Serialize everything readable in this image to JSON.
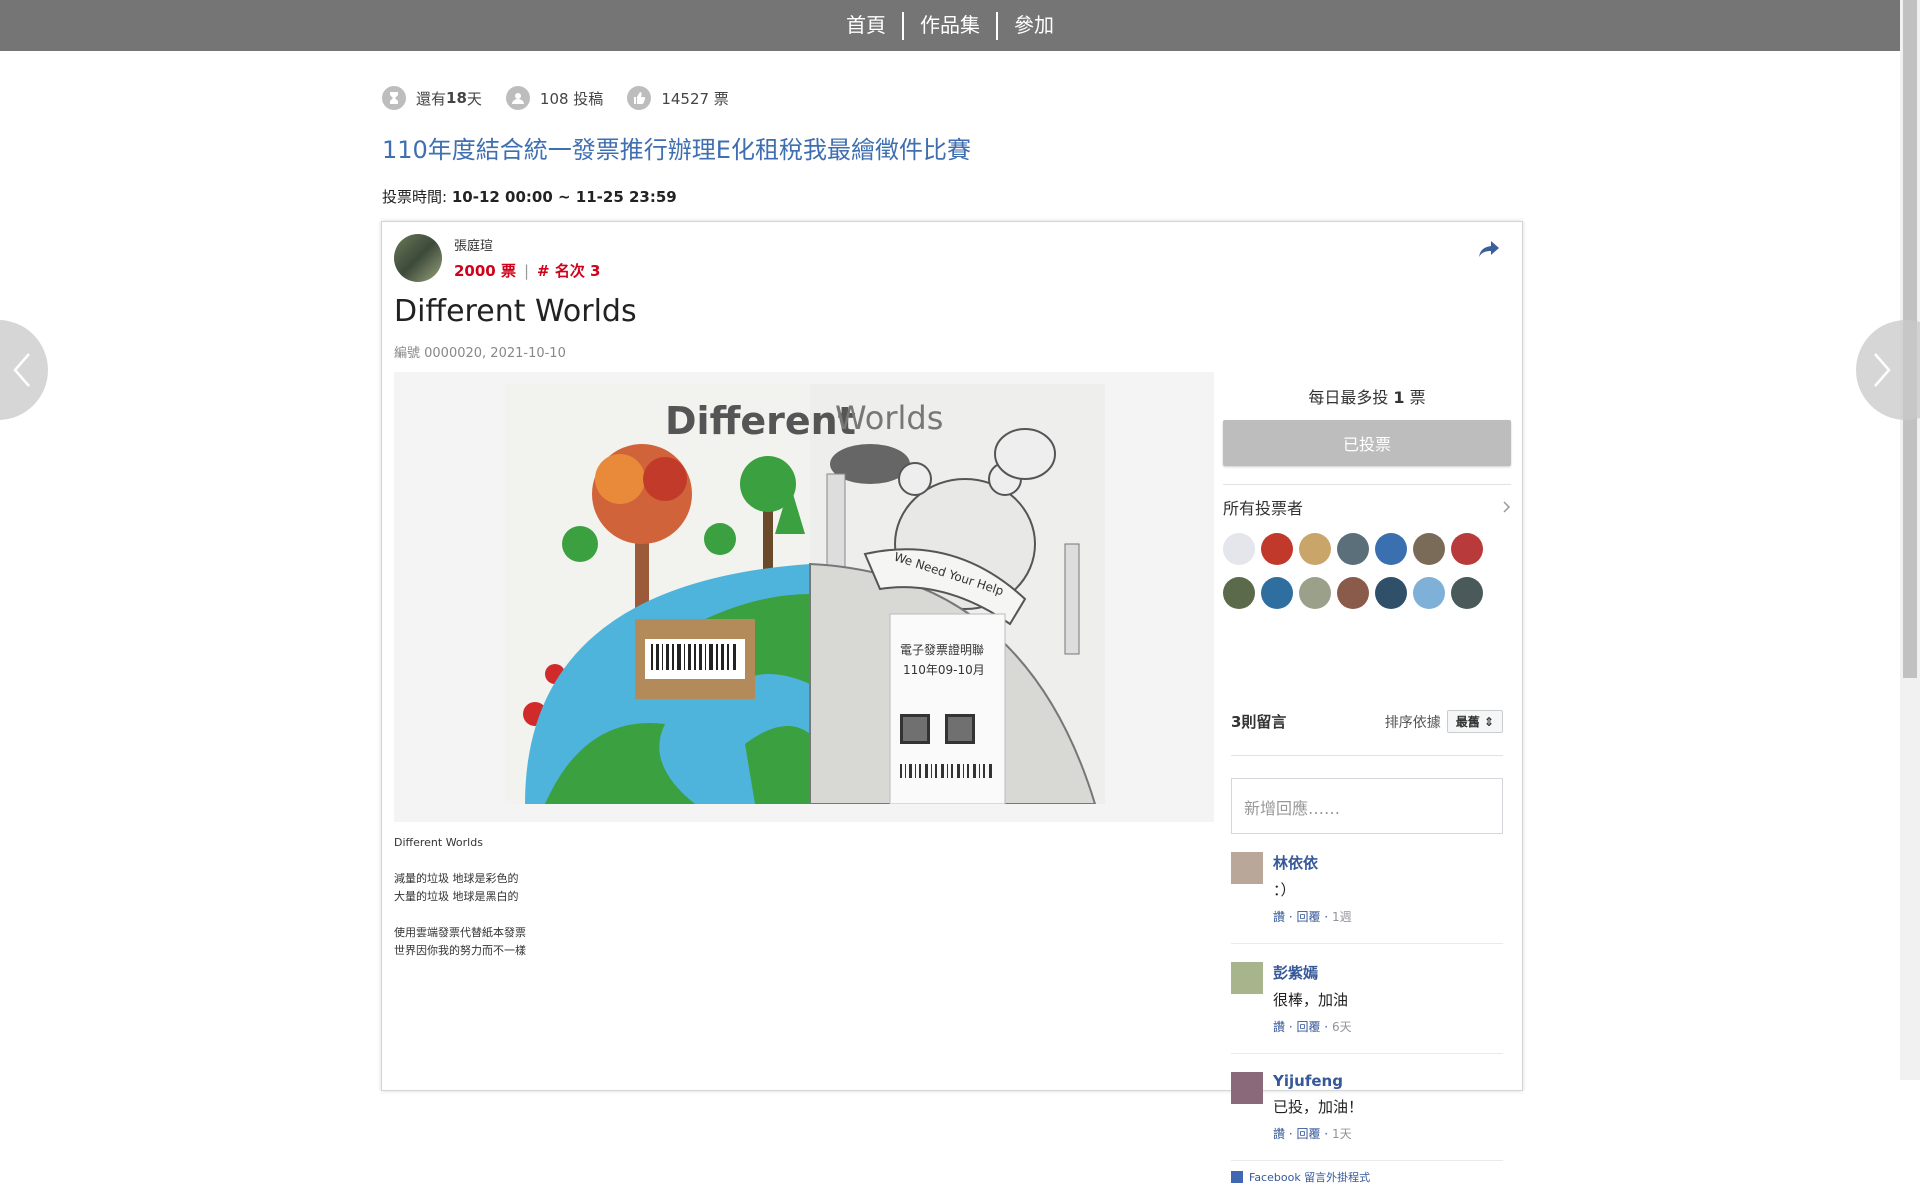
{
  "nav": {
    "items": [
      "首頁",
      "作品集",
      "參加"
    ]
  },
  "stats": {
    "remaining_prefix": "還有",
    "remaining_days": "18",
    "remaining_suffix": "天",
    "submissions": "108 投稿",
    "votes": "14527 票"
  },
  "contest": {
    "title": "110年度結合統一發票推行辦理E化租稅我最繪徵件比賽",
    "vote_time_label": "投票時間:",
    "vote_time_value": "10-12 00:00 ~ 11-25 23:59"
  },
  "entry": {
    "author": "張庭瑄",
    "votes_text": "2000 票",
    "rank_text": "# 名次 3",
    "title": "Different Worlds",
    "meta": "編號 0000020, 2021-10-10",
    "description": "Different Worlds\n\n減量的垃圾 地球是彩色的\n大量的垃圾 地球是黑白的\n\n使用雲端發票代替紙本發票\n世界因你我的努力而不一樣"
  },
  "artwork_text": {
    "heading_left": "Different",
    "heading_right": "Worlds",
    "banner": "We Need Your Help",
    "receipt_title": "電子發票證明聯",
    "receipt_period": "110年09-10月"
  },
  "voting": {
    "limit_prefix": "每日最多投",
    "limit_count": "1",
    "limit_suffix": "票",
    "button_label": "已投票",
    "voters_heading": "所有投票者"
  },
  "voter_colors": [
    "#e4e6eb",
    "#c0392b",
    "#c9a56a",
    "#5b6f7a",
    "#3a6fb0",
    "#7a6a58",
    "#b93a3a",
    "#5a6a4a",
    "#2e6fa0",
    "#9aa08a",
    "#8a5a4a",
    "#30506a",
    "#7fb0d8",
    "#4a5a5a"
  ],
  "comments": {
    "count_label": "3則留言",
    "sort_label": "排序依據",
    "sort_value": "最舊",
    "input_placeholder": "新增回應……",
    "items": [
      {
        "name": "林依依",
        "text": "：）",
        "like": "讚",
        "reply": "回覆",
        "time": "1週",
        "color": "#b9a79a"
      },
      {
        "name": "彭紫嫣",
        "text": "很棒，加油",
        "like": "讚",
        "reply": "回覆",
        "time": "6天",
        "color": "#a8b48c"
      },
      {
        "name": "Yijufeng",
        "text": "已投，加油！",
        "like": "讚",
        "reply": "回覆",
        "time": "1天",
        "color": "#8a6a7a"
      }
    ],
    "plugin_label": "Facebook 留言外掛程式"
  }
}
